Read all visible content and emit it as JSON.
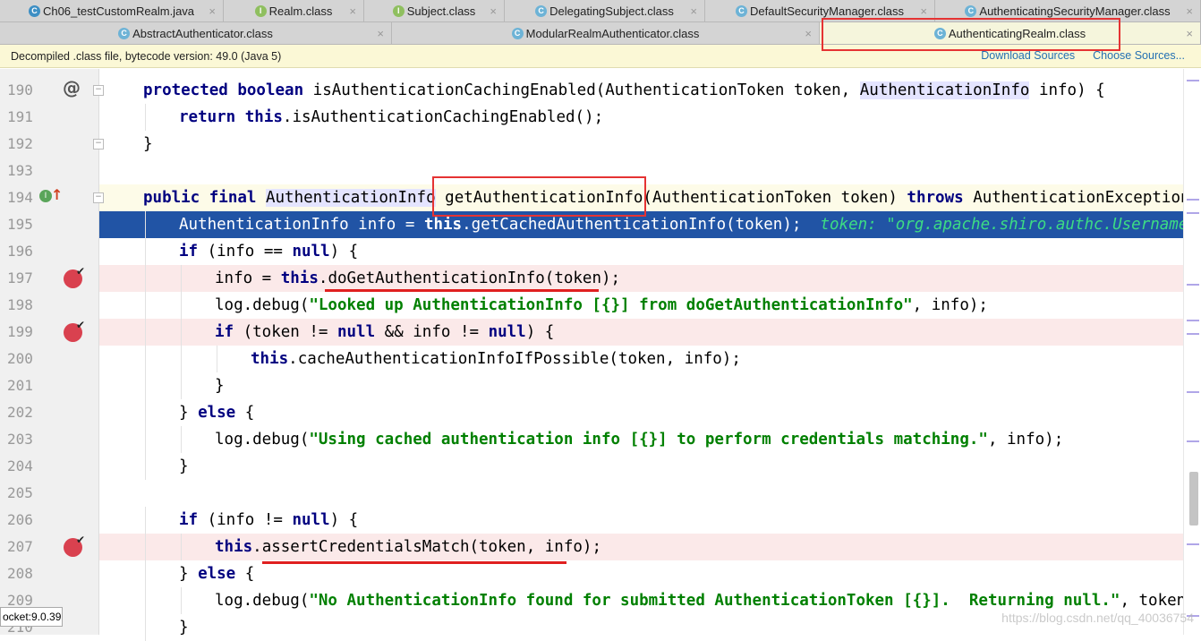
{
  "tabs_row1": [
    {
      "label": "Ch06_testCustomRealm.java",
      "icon": "java-class-icon",
      "w": 250
    },
    {
      "label": "Realm.class",
      "icon": "interface-icon",
      "w": 157
    },
    {
      "label": "Subject.class",
      "icon": "interface-icon",
      "w": 157
    },
    {
      "label": "DelegatingSubject.class",
      "icon": "class-icon",
      "w": 224
    },
    {
      "label": "DefaultSecurityManager.class",
      "icon": "class-icon",
      "w": 257
    },
    {
      "label": "AuthenticatingSecurityManager.class",
      "icon": "class-icon",
      "w": 297
    }
  ],
  "tabs_row2": [
    {
      "label": "AbstractAuthenticator.class",
      "icon": "class-icon",
      "w": 438
    },
    {
      "label": "ModularRealmAuthenticator.class",
      "icon": "class-icon",
      "w": 478
    },
    {
      "label": "AuthenticatingRealm.class",
      "icon": "class-icon",
      "w": 426,
      "active": true
    }
  ],
  "notice": {
    "text": "Decompiled .class file, bytecode version: 49.0 (Java 5)",
    "download_sources": "Download Sources",
    "choose_sources": "Choose Sources..."
  },
  "lines": [
    {
      "n": "190",
      "indent": 1,
      "gutter": "@",
      "fold": "−",
      "segs": [
        [
          "kw",
          "protected boolean "
        ],
        [
          "",
          "isAuthenticationCachingEnabled(AuthenticationToken token, "
        ],
        [
          "hl",
          "AuthenticationInfo"
        ],
        [
          "",
          " info) {"
        ]
      ]
    },
    {
      "n": "191",
      "indent": 2,
      "segs": [
        [
          "kw",
          "return this"
        ],
        [
          "",
          ".isAuthenticationCachingEnabled();"
        ]
      ]
    },
    {
      "n": "192",
      "indent": 1,
      "fold": "−",
      "segs": [
        [
          "",
          "}"
        ]
      ]
    },
    {
      "n": "193",
      "indent": 0,
      "segs": []
    },
    {
      "n": "194",
      "indent": 1,
      "state": "current",
      "gutter": "impl",
      "fold": "−",
      "segs": [
        [
          "kw",
          "public final "
        ],
        [
          "hl",
          "AuthenticationInfo"
        ],
        [
          "",
          " getAuthenticationInfo(AuthenticationToken token) "
        ],
        [
          "kw",
          "throws "
        ],
        [
          "",
          "AuthenticationException {  "
        ],
        [
          "hint",
          "t"
        ]
      ]
    },
    {
      "n": "195",
      "indent": 2,
      "state": "exec",
      "segs": [
        [
          "",
          "AuthenticationInfo info = "
        ],
        [
          "kw",
          "this"
        ],
        [
          "",
          ".getCachedAuthenticationInfo(token);  "
        ],
        [
          "hint",
          "token: \"org.apache.shiro.authc.UsernamePasswordToken"
        ]
      ]
    },
    {
      "n": "196",
      "indent": 2,
      "segs": [
        [
          "kw",
          "if "
        ],
        [
          "",
          "(info == "
        ],
        [
          "kw",
          "null"
        ],
        [
          "",
          ") {"
        ]
      ]
    },
    {
      "n": "197",
      "indent": 3,
      "state": "bp",
      "segs": [
        [
          "",
          "info = "
        ],
        [
          "kw",
          "this"
        ],
        [
          "",
          ".doGetAuthenticationInfo(token);"
        ]
      ]
    },
    {
      "n": "198",
      "indent": 3,
      "segs": [
        [
          "",
          "log.debug("
        ],
        [
          "str",
          "\"Looked up AuthenticationInfo [{}] from doGetAuthenticationInfo\""
        ],
        [
          "",
          ", info);"
        ]
      ]
    },
    {
      "n": "199",
      "indent": 3,
      "state": "bp",
      "segs": [
        [
          "kw",
          "if "
        ],
        [
          "",
          "(token != "
        ],
        [
          "kw",
          "null "
        ],
        [
          "",
          "&& info != "
        ],
        [
          "kw",
          "null"
        ],
        [
          "",
          ") {"
        ]
      ]
    },
    {
      "n": "200",
      "indent": 4,
      "segs": [
        [
          "kw",
          "this"
        ],
        [
          "",
          ".cacheAuthenticationInfoIfPossible(token, info);"
        ]
      ]
    },
    {
      "n": "201",
      "indent": 3,
      "segs": [
        [
          "",
          "}"
        ]
      ]
    },
    {
      "n": "202",
      "indent": 2,
      "segs": [
        [
          "",
          "} "
        ],
        [
          "kw",
          "else "
        ],
        [
          "",
          "{"
        ]
      ]
    },
    {
      "n": "203",
      "indent": 3,
      "segs": [
        [
          "",
          "log.debug("
        ],
        [
          "str",
          "\"Using cached authentication info [{}] to perform credentials matching.\""
        ],
        [
          "",
          ", info);"
        ]
      ]
    },
    {
      "n": "204",
      "indent": 2,
      "segs": [
        [
          "",
          "}"
        ]
      ]
    },
    {
      "n": "205",
      "indent": 0,
      "segs": []
    },
    {
      "n": "206",
      "indent": 2,
      "segs": [
        [
          "kw",
          "if "
        ],
        [
          "",
          "(info != "
        ],
        [
          "kw",
          "null"
        ],
        [
          "",
          ") {"
        ]
      ]
    },
    {
      "n": "207",
      "indent": 3,
      "state": "bp",
      "segs": [
        [
          "kw",
          "this"
        ],
        [
          "",
          ".assertCredentialsMatch(token, info);"
        ]
      ]
    },
    {
      "n": "208",
      "indent": 2,
      "segs": [
        [
          "",
          "} "
        ],
        [
          "kw",
          "else "
        ],
        [
          "",
          "{"
        ]
      ]
    },
    {
      "n": "209",
      "indent": 3,
      "segs": [
        [
          "",
          "log.debug("
        ],
        [
          "str",
          "\"No AuthenticationInfo found for submitted AuthenticationToken [{}].  Returning null.\""
        ],
        [
          "",
          ", token);"
        ]
      ]
    },
    {
      "n": "210",
      "indent": 2,
      "segs": [
        [
          "",
          "}"
        ]
      ]
    }
  ],
  "tooltip": "ocket:9.0.39",
  "watermark": "https://blog.csdn.net/qq_40036754",
  "colors": {
    "keyword": "#000080",
    "string": "#008000",
    "exec_line": "#2154a5",
    "breakpoint_line": "#fbe9e9",
    "annotation": "#e53333"
  }
}
